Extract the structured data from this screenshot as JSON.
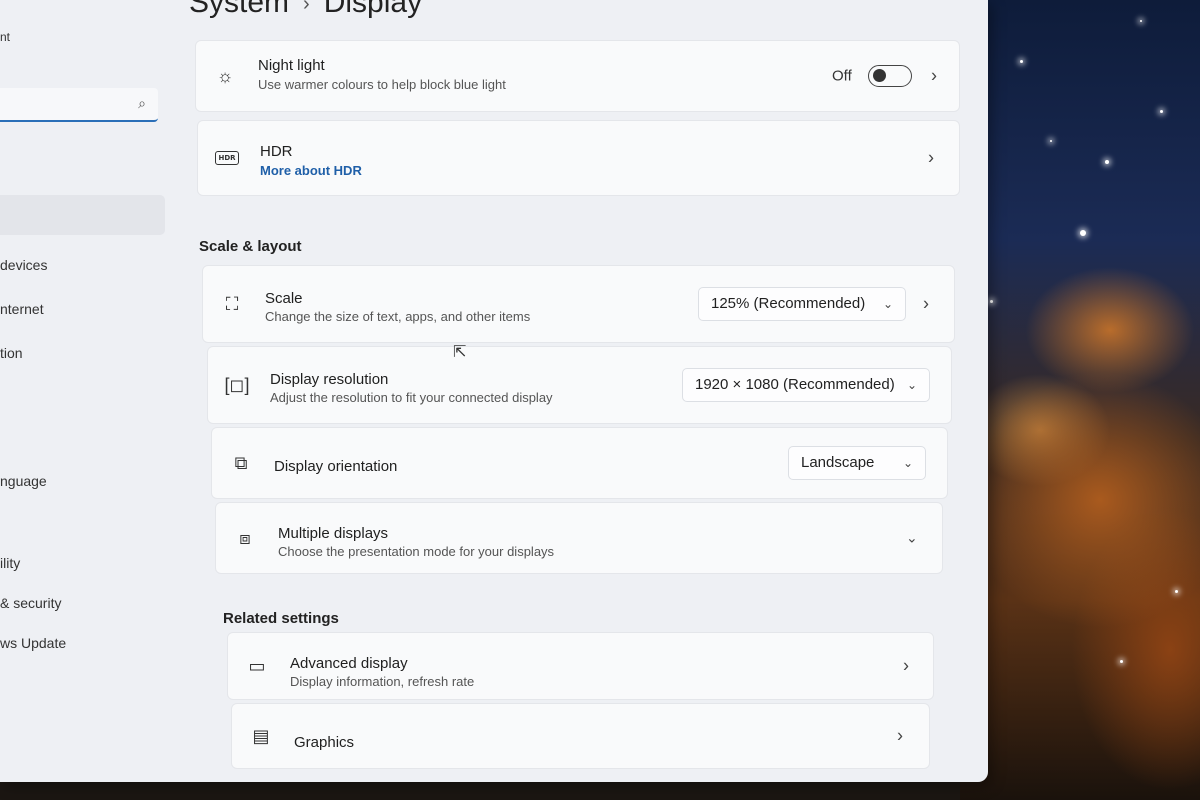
{
  "window": {
    "breadcrumb_parent": "System",
    "breadcrumb_separator": "›",
    "breadcrumb_current": "Display"
  },
  "sidebar": {
    "top_fragment": "nt",
    "search_icon": "⌕",
    "items": [
      {
        "label": "devices"
      },
      {
        "label": "nternet"
      },
      {
        "label": "tion"
      },
      {
        "label": "nguage"
      },
      {
        "label": "ility"
      },
      {
        "label": "& security"
      },
      {
        "label": "ws Update"
      }
    ]
  },
  "night_light": {
    "title": "Night light",
    "subtitle": "Use warmer colours to help block blue light",
    "toggle_state": "Off",
    "icon": "brightness-icon"
  },
  "hdr": {
    "title": "HDR",
    "link": "More about HDR",
    "icon_text": "HDR"
  },
  "scale_layout": {
    "section_title": "Scale & layout",
    "scale": {
      "title": "Scale",
      "subtitle": "Change the size of text, apps, and other items",
      "value": "125% (Recommended)"
    },
    "resolution": {
      "title": "Display resolution",
      "subtitle": "Adjust the resolution to fit your connected display",
      "value": "1920 × 1080 (Recommended)"
    },
    "orientation": {
      "title": "Display orientation",
      "value": "Landscape"
    },
    "multiple": {
      "title": "Multiple displays",
      "subtitle": "Choose the presentation mode for your displays"
    }
  },
  "related": {
    "section_title": "Related settings",
    "advanced": {
      "title": "Advanced display",
      "subtitle": "Display information, refresh rate"
    },
    "graphics": {
      "title": "Graphics"
    }
  },
  "glyphs": {
    "chevron_right": "›",
    "chevron_down": "⌄",
    "cursor": "⇱"
  },
  "colors": {
    "accent": "#1f5fa8",
    "window_bg": "#eef0f4",
    "card_bg": "#f9fafb"
  }
}
